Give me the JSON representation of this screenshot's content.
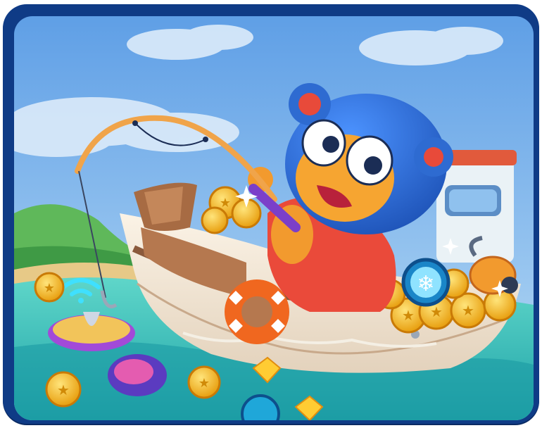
{
  "scene": {
    "type": "game-illustration-card",
    "subject": "bear",
    "colors": {
      "frame": "#0f3b86",
      "sky": "#7fb6ea",
      "sea": "#35c1b8",
      "boat": "#f2e6d6",
      "bear": "#2a6fd6",
      "coin": "#f5b81c"
    },
    "icons": [
      "fishing-rod-icon",
      "life-ring-icon",
      "coin-icon",
      "snowflake-icon",
      "vacuum-icon",
      "magnet-icon",
      "wifi-signal-icon"
    ]
  }
}
